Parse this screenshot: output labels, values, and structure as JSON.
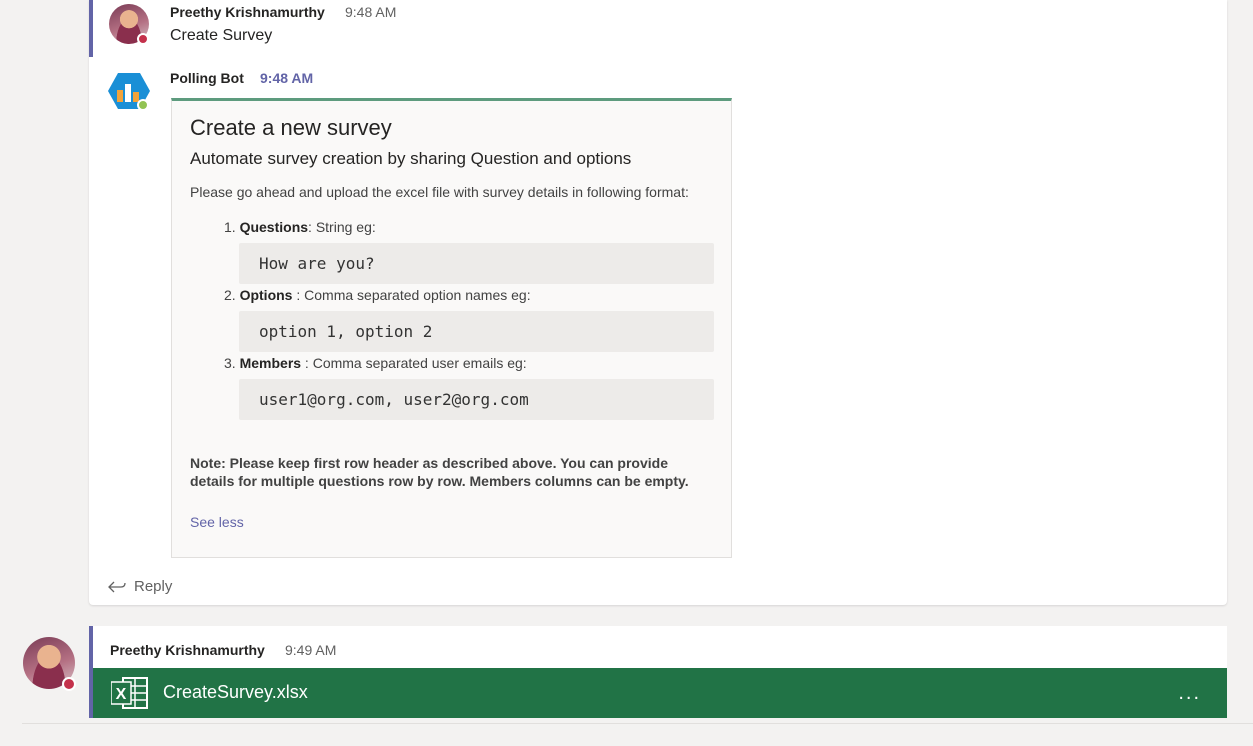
{
  "message1": {
    "sender": "Preethy Krishnamurthy",
    "time": "9:48 AM",
    "text": "Create Survey"
  },
  "bot_message": {
    "sender": "Polling Bot",
    "time": "9:48 AM",
    "card": {
      "title": "Create a new survey",
      "subtitle": "Automate survey creation by sharing Question and options",
      "intro": "Please go ahead and upload the excel file with survey details in following format:",
      "items": [
        {
          "num": "1.",
          "label": "Questions",
          "desc": ": String eg:",
          "example": "How are you?"
        },
        {
          "num": "2.",
          "label": "Options",
          "desc": " : Comma separated option names eg:",
          "example": "option 1, option 2"
        },
        {
          "num": "3.",
          "label": "Members",
          "desc": " : Comma separated user emails eg:",
          "example": "user1@org.com, user2@org.com"
        }
      ],
      "note": "Note: Please keep first row header as described above. You can provide details for multiple questions row by row. Members columns can be empty.",
      "see_less": "See less"
    }
  },
  "reply_label": "Reply",
  "message2": {
    "sender": "Preethy Krishnamurthy",
    "time": "9:49 AM",
    "attachment": {
      "file_name": "CreateSurvey.xlsx",
      "icon": "excel-icon",
      "more": "..."
    }
  },
  "colors": {
    "accent": "#6264a7",
    "excel": "#217346",
    "card_top": "#5d9b7e",
    "status_busy": "#c4314b",
    "status_ok": "#92c353"
  }
}
